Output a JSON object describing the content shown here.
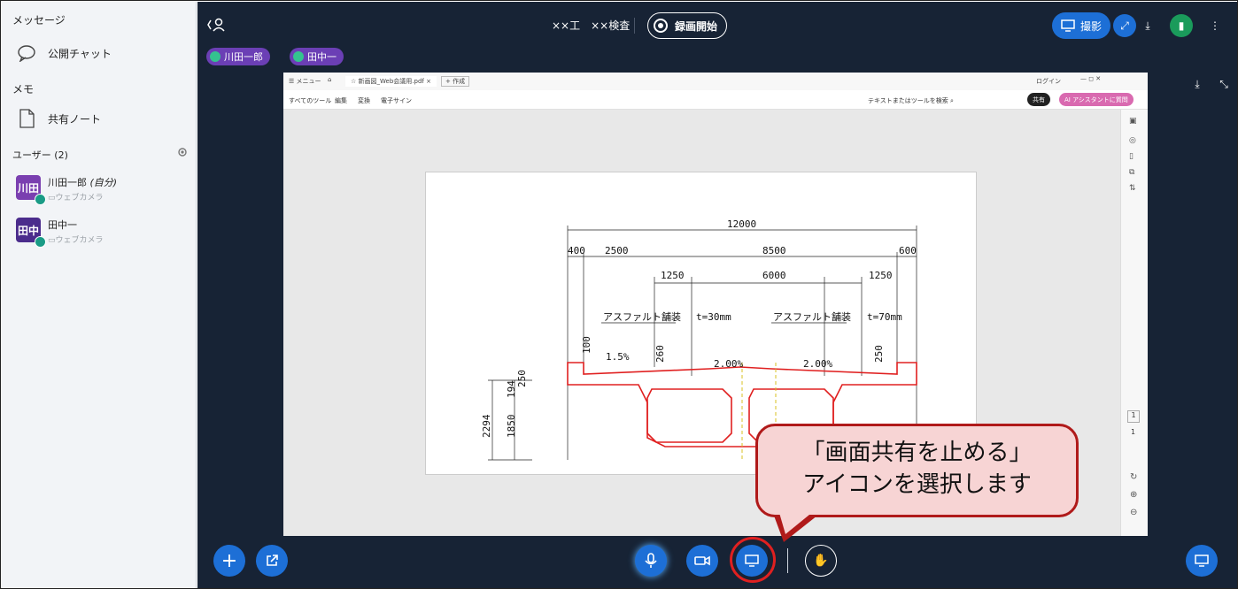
{
  "sidebar": {
    "messages_heading": "メッセージ",
    "public_chat": "公開チャット",
    "memo_heading": "メモ",
    "shared_notes": "共有ノート",
    "users_heading": "ユーザー (2)",
    "users": [
      {
        "avatar_text": "川田",
        "name": "川田一郎",
        "self_tag": "(自分)",
        "sub": "ウェブカメラ",
        "color": "#7a3fb0"
      },
      {
        "avatar_text": "田中",
        "name": "田中一",
        "sub": "ウェブカメラ",
        "color": "#4b2c8c"
      }
    ]
  },
  "top": {
    "title": "××工　××検査",
    "record_label": "録画開始",
    "capture_label": "撮影",
    "chips": [
      "川田一郎",
      "田中一"
    ]
  },
  "pdf": {
    "menu_label": "メニュー",
    "tab_label": "新画図_Web会議用.pdf",
    "new_tab_label": "+ 作成",
    "login_label": "ログイン",
    "tools": [
      "すべてのツール",
      "編集",
      "変換",
      "電子サイン"
    ],
    "search_placeholder": "テキストまたはツールを検索",
    "share_label": "共有",
    "ai_label": "AI アシスタントに質問",
    "page_number": "1",
    "page_total": "1",
    "drawing": {
      "dim_total": "12000",
      "dim_top": [
        "400",
        "2500",
        "8500",
        "600"
      ],
      "dim_mid": [
        "1250",
        "6000",
        "1250"
      ],
      "pavement_left": "アスファルト舗装",
      "pavement_left_t": "t=30mm",
      "pavement_right": "アスファルト舗装",
      "pavement_right_t": "t=70mm",
      "slope_left": "1.5%",
      "slope_mid_left": "2.00%",
      "slope_mid_right": "2.00%",
      "h100": "100",
      "h260": "260",
      "h250_right": "250",
      "h250_left": "250",
      "h194": "194",
      "h1850": "1850",
      "h2294": "2294"
    }
  },
  "callout": {
    "line1": "「画面共有を止める」",
    "line2": "アイコンを選択します"
  },
  "colors": {
    "sidebar_bg": "#f2f4f7",
    "main_bg": "#172335",
    "accent_blue": "#1d6fd6",
    "purple": "#6b3fb5",
    "callout_red": "#b01a1a"
  }
}
